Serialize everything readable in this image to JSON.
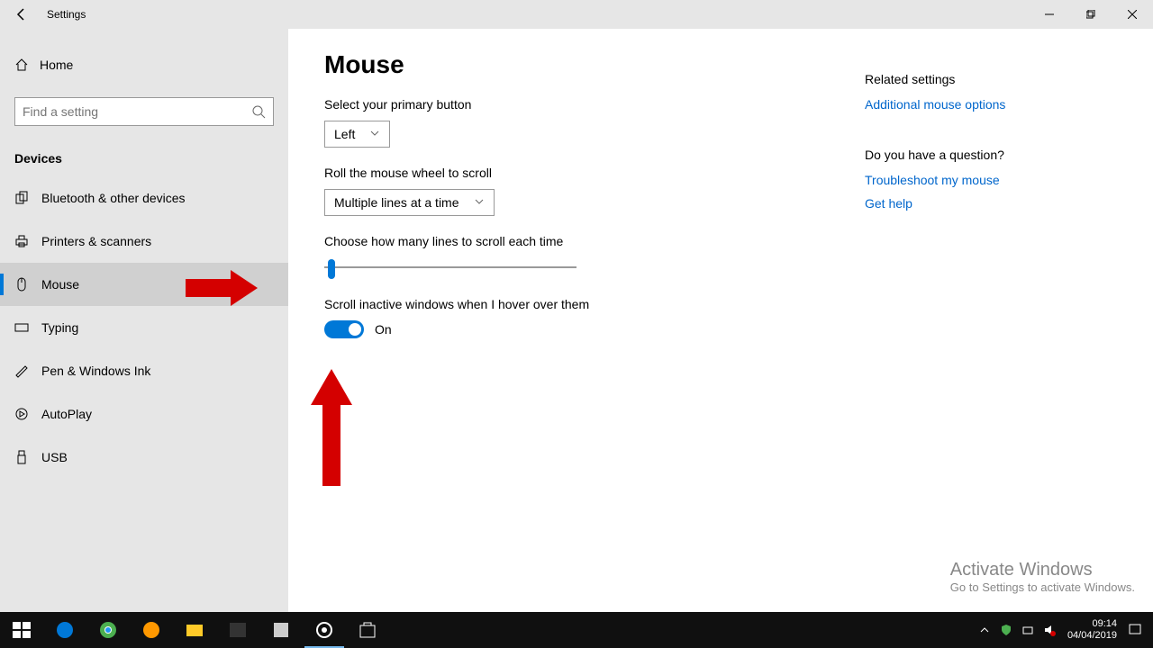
{
  "window": {
    "title": "Settings"
  },
  "sidebar": {
    "home": "Home",
    "search_placeholder": "Find a setting",
    "section": "Devices",
    "items": [
      {
        "label": "Bluetooth & other devices"
      },
      {
        "label": "Printers & scanners"
      },
      {
        "label": "Mouse"
      },
      {
        "label": "Typing"
      },
      {
        "label": "Pen & Windows Ink"
      },
      {
        "label": "AutoPlay"
      },
      {
        "label": "USB"
      }
    ]
  },
  "page": {
    "title": "Mouse",
    "primary_label": "Select your primary button",
    "primary_value": "Left",
    "scroll_label": "Roll the mouse wheel to scroll",
    "scroll_value": "Multiple lines at a time",
    "lines_label": "Choose how many lines to scroll each time",
    "inactive_label": "Scroll inactive windows when I hover over them",
    "toggle_state": "On"
  },
  "related": {
    "header": "Related settings",
    "link1": "Additional mouse options",
    "question_header": "Do you have a question?",
    "link2": "Troubleshoot my mouse",
    "link3": "Get help"
  },
  "watermark": {
    "line1": "Activate Windows",
    "line2": "Go to Settings to activate Windows."
  },
  "taskbar": {
    "time": "09:14",
    "date": "04/04/2019"
  }
}
